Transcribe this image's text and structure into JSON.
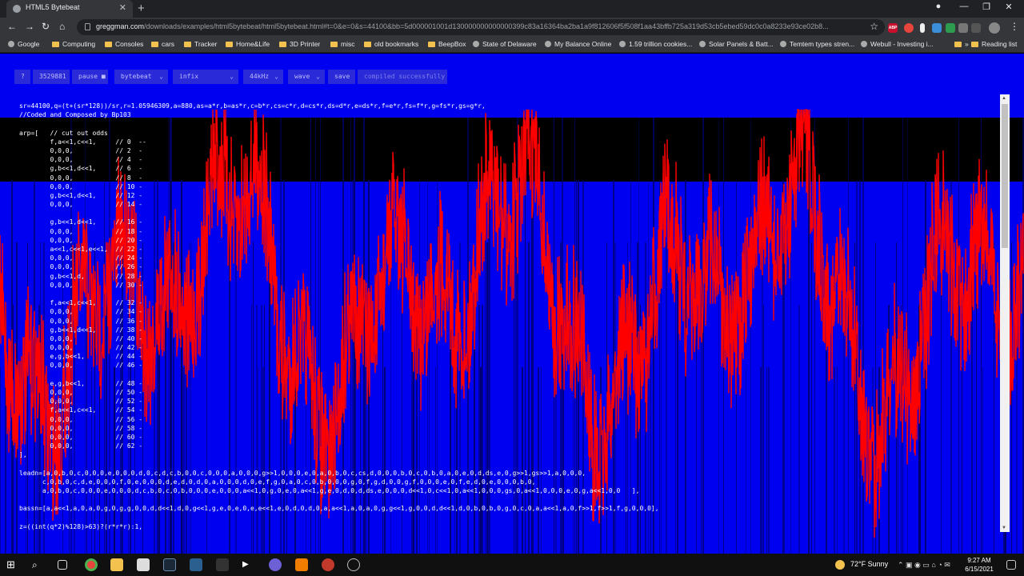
{
  "browser": {
    "tab_title": "HTML5 Bytebeat",
    "url_host": "greggman.com",
    "url_rest": "/downloads/examples/html5bytebeat/html5bytebeat.html#t=0&e=0&s=44100&bb=5d000001001d130000000000000399c83a16364ba2ba1a9f812606f5f508f1aa43bffb725a319d53cb5ebed59dc0c0a8233e93ce02b8...",
    "bookmarks": [
      "Google",
      "Computing",
      "Consoles",
      "cars",
      "Tracker",
      "Home&Life",
      "3D Printer",
      "misc",
      "old bookmarks",
      "BeepBox",
      "State of Delaware",
      "My Balance Online",
      "1.59 trillion cookies...",
      "Solar Panels & Batt...",
      "Temtem types stren...",
      "Webull - Investing i...",
      "Reading list"
    ],
    "overflow": "»",
    "extensions": [
      "ABP"
    ]
  },
  "controls": {
    "help": "?",
    "time": "3529881",
    "pause": "pause ■",
    "type": "bytebeat",
    "expression": "infix",
    "rate": "44kHz",
    "view": "wave",
    "save": "save",
    "status": "compiled successfully"
  },
  "code_lines": [
    "sr=44100,q=(t+(sr*128))/sr,r=1.05946309,a=880,as=a*r,b=as*r,c=b*r,cs=c*r,d=cs*r,ds=d*r,e=ds*r,f=e*r,fs=f*r,g=fs*r,gs=g*r,",
    "//Coded and Composed by Bp103",
    "",
    "arp=[   // cut out odds",
    "        f,a<<1,c<<1,     // 0  --",
    "        0,0,0,           // 2  -",
    "        0,0,0,           // 4  -",
    "        g,b<<1,d<<1,     // 6  -",
    "        0,0,0,           // 8  -",
    "        0,0,0,           // 10 -",
    "        g,b<<1,d<<1,     // 12 -",
    "        0,0,0,           // 14 -",
    "",
    "        g,b<<1,d<<1,     // 16 -",
    "        0,0,0,           // 18 -",
    "        0,0,0,           // 20 -",
    "        a<<1,c<<1,e<<1,  // 22 -",
    "        0,0,0,           // 24 -",
    "        0,0,0,           // 26 -",
    "        g,b<<1,d,        // 28 -",
    "        0,0,0,           // 30 -",
    "",
    "        f,a<<1,c<<1,     // 32 -",
    "        0,0,0,           // 34 -",
    "        0,0,0,           // 36 -",
    "        g,b<<1,d<<1,     // 38 -",
    "        0,0,0,           // 40 -",
    "        0,0,0,           // 42 -",
    "        e,g,b<<1,        // 44 -",
    "        0,0,0,           // 46 -",
    "",
    "        e,g,b<<1,        // 48 -",
    "        0,0,0,           // 50 -",
    "        0,0,0,           // 52 -",
    "        f,a<<1,c<<1,     // 54 -",
    "        0,0,0,           // 56 -",
    "        0,0,0,           // 58 -",
    "        0,0,0,           // 60 -",
    "        0,0,0,           // 62 -",
    "],",
    "",
    "leadn=[a,0,b,0,c,0,0,0,e,0,0,0,d,0,c,d,c,b,0,0,c,0,0,0,a,0,0,0,g>>1,0,0,0,e,0,a,0,b,0,c,cs,d,0,0,0,b,0,c,0,b,0,a,0,e,0,d,ds,e,0,g>>1,gs>>1,a,0,0,0,",
    "      c,0,b,0,c,d,e,0,0,0,f,0,e,0,0,0,d,e,d,0,d,0,a,0,0,0,d,0,e,f,g,0,a,0,c,0,b,0,0,0,g,0,f,g,d,0,0,g,f,0,0,0,e,0,f,e,d,0,e,0,0,0,b,0,",
    "      a,0,b,0,c,0,0,0,e,0,0,0,d,c,b,0,c,0,b,0,0,0,e,0,0,0,a<<1,0,g,0,e,0,a<<1,g,e,0,d,0,d,ds,e,0,0,0,d<<1,0,c<<1,0,a<<1,0,0,0,gs,0,a<<1,0,0,0,e,0,g,a<<1,0,0   ],",
    "",
    "bassn=[a,a<<1,a,0,a,0,g,0,g,g,0,0,d,d<<1,d,0,g<<1,g,e,0,e,0,e,e<<1,e,0,d,0,d,0,a,a<<1,a,0,a,0,g,g<<1,g,0,0,d,d<<1,d,0,b,0,b,0,g,0,c,0,a,a<<1,a,0,f>>1,f>>1,f,g,0,0,0],",
    "",
    "z=((int(q*2)%128)>63)?(r*r*r):1,"
  ],
  "scrollbar": {
    "up": "▲",
    "down": "▼"
  },
  "taskbar": {
    "weather": "72°F  Sunny",
    "time": "9:27 AM",
    "date": "6/15/2021"
  },
  "colors": {
    "page_bg": "#0000f0",
    "wave": "#ff0000",
    "dark_band": "#000000"
  }
}
